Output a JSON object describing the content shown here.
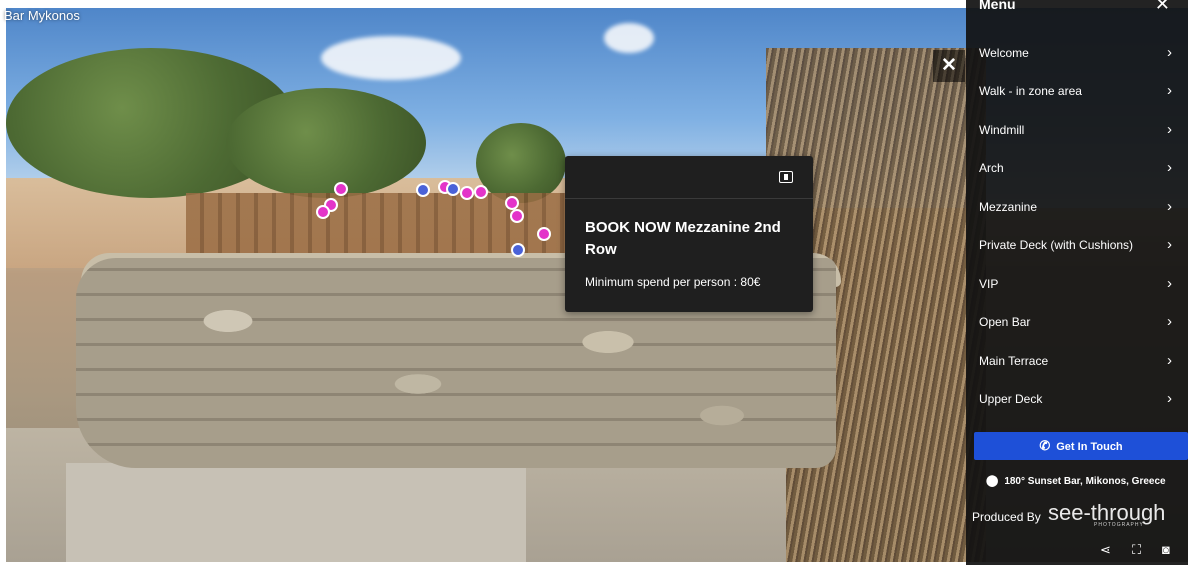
{
  "tour": {
    "title": "Bar Mykonos"
  },
  "popup": {
    "title": "BOOK NOW Mezzanine 2nd Row",
    "description": "Minimum spend per person : 80€",
    "icon": "expand-panel-icon"
  },
  "close_button": {
    "label": "✕"
  },
  "menu": {
    "header": "Menu",
    "close": "✕",
    "chevron": "›",
    "items": [
      {
        "label": "Welcome"
      },
      {
        "label": "Walk - in zone area"
      },
      {
        "label": "Windmill"
      },
      {
        "label": "Arch"
      },
      {
        "label": "Mezzanine"
      },
      {
        "label": "Private Deck (with Cushions)"
      },
      {
        "label": "VIP"
      },
      {
        "label": "Open Bar"
      },
      {
        "label": "Main Terrace"
      },
      {
        "label": "Upper Deck"
      }
    ],
    "cta": {
      "label": "Get In Touch",
      "icon": "phone-icon",
      "color": "#1e50d8"
    },
    "location": {
      "label": "180° Sunset Bar, Mikonos, Greece",
      "icon": "map-pin-icon"
    },
    "produced_by": "Produced By",
    "logo_text": "see-through",
    "logo_subtext": "PHOTOGRAPHY"
  },
  "toolbar": {
    "icons": [
      "share-icon",
      "fullscreen-icon",
      "vr-headset-icon"
    ],
    "glyphs": {
      "share": "⋖",
      "fullscreen": "⛶",
      "vr": "◙"
    }
  },
  "colors": {
    "hotspot_pink": "#e334c9",
    "hotspot_blue": "#4a62d8",
    "menu_bg": "#121212"
  }
}
